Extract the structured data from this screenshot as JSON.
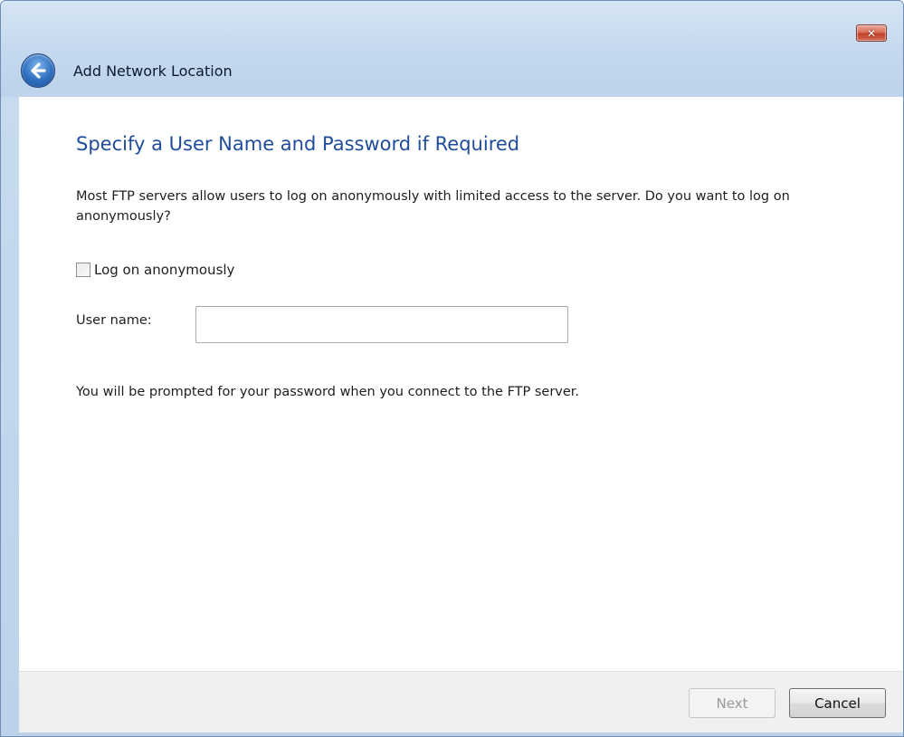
{
  "window": {
    "title": "Add Network Location",
    "close_label": "✕"
  },
  "main": {
    "heading": "Specify a User Name and Password if Required",
    "description": "Most FTP servers allow users to log on anonymously with limited access to the server.  Do you want to log on anonymously?",
    "anonymous_checkbox": {
      "label": "Log on anonymously",
      "checked": false
    },
    "username": {
      "label": "User name:",
      "value": "",
      "placeholder": ""
    },
    "password_note": "You will be prompted for your password when you connect to the FTP server."
  },
  "footer": {
    "next_label": "Next",
    "cancel_label": "Cancel"
  },
  "colors": {
    "heading": "#1f4d9a",
    "titlebar": "#c4d8ee",
    "close_button": "#c2412a",
    "footer_bg": "#f0f0f0"
  },
  "icons": {
    "back": "back-arrow-icon",
    "close": "close-icon"
  }
}
